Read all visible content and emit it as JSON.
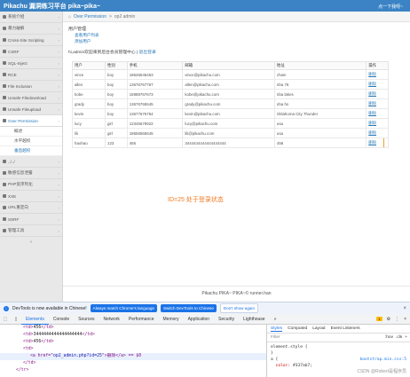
{
  "header": {
    "brand": "Pikachu 漏洞练习平台 pika~pika~",
    "right_link": "点一下我呀~"
  },
  "sidebar": {
    "items": [
      {
        "label": "系统介绍",
        "active": false
      },
      {
        "label": "暴力破解",
        "active": false
      },
      {
        "label": "Cross-Site Scripting",
        "active": false
      },
      {
        "label": "CSRF",
        "active": false
      },
      {
        "label": "SQL-Inject",
        "active": false
      },
      {
        "label": "RCE",
        "active": false
      },
      {
        "label": "File Inclusion",
        "active": false
      },
      {
        "label": "Unsafe Filedownload",
        "active": false
      },
      {
        "label": "Unsafe Fileupload",
        "active": false
      },
      {
        "label": "Over Permission",
        "active": true
      }
    ],
    "subitems": [
      {
        "label": "概述"
      },
      {
        "label": "水平越权"
      },
      {
        "label": "垂直越权"
      }
    ],
    "items2": [
      {
        "label": "../../"
      },
      {
        "label": "敏感信息泄露"
      },
      {
        "label": "PHP反序列化"
      },
      {
        "label": "XXE"
      },
      {
        "label": "URL重定向"
      },
      {
        "label": "SSRF"
      },
      {
        "label": "管理工具"
      }
    ],
    "collapse": "«"
  },
  "breadcrumb": {
    "home": "Over Permission",
    "sep": ">",
    "current": "op2 admin"
  },
  "content": {
    "title": "用户管理",
    "links": [
      "查看用户列表",
      "添加用户"
    ],
    "welcome": "hi,admin欢迎来到后台会员管理中心 |",
    "logout": "退出登录"
  },
  "table": {
    "headers": [
      "用户",
      "性别",
      "手机",
      "邮箱",
      "地址",
      "操作"
    ],
    "rows": [
      [
        "vince",
        "boy",
        "18626545453",
        "vince@pikachu.com",
        "chain",
        "删除"
      ],
      [
        "allen",
        "boy",
        "13676767767",
        "allen@pikachu.com",
        "nba 76",
        "删除"
      ],
      [
        "kobe",
        "boy",
        "15988767673",
        "kobe@pikachu.com",
        "nba lakes",
        "删除"
      ],
      [
        "grady",
        "boy",
        "13676765545",
        "grady@pikachu.com",
        "nba hs",
        "删除"
      ],
      [
        "kevin",
        "boy",
        "13677676754",
        "kevin@pikachu.com",
        "Oklahoma City Thunder",
        "删除"
      ],
      [
        "lucy",
        "girl",
        "12345678922",
        "lucy@pikachu.com",
        "usa",
        "删除"
      ],
      [
        "lili",
        "girl",
        "18656565545",
        "lili@pikachu.com",
        "usa",
        "删除"
      ],
      [
        "haohao",
        "123",
        "456",
        "3444444444444444444",
        "456",
        "删除"
      ]
    ]
  },
  "annotation": "ID=25 处于登录状态",
  "footer": "Pikachu PIKA~ PIKA~© runner.han",
  "devtools": {
    "infobar": {
      "text": "DevTools is now available in Chinese!",
      "btn1": "Always match Chrome's language",
      "btn2": "Switch DevTools to Chinese",
      "btn3": "Don't show again",
      "close": "×"
    },
    "tabs": [
      "Elements",
      "Console",
      "Sources",
      "Network",
      "Performance",
      "Memory",
      "Application",
      "Security",
      "Lighthouse"
    ],
    "more": "»",
    "badge": "1",
    "elements_lines": [
      {
        "pre": "<td>",
        "text": "456",
        "post": "</td>"
      },
      {
        "pre": "<td>",
        "text": "3444444444444444444",
        "post": "</td>"
      },
      {
        "pre": "<td>",
        "text": "456",
        "post": "</td>"
      },
      {
        "pre": "<td>",
        "text": "",
        "post": ""
      },
      {
        "pre": "<a href=\"",
        "text": "op2_admin.php?id=25",
        "post": "\">删除</a> == $0"
      },
      {
        "pre": "</td>",
        "text": "",
        "post": ""
      },
      {
        "pre": "</tr>",
        "text": "",
        "post": ""
      }
    ],
    "styles_tabs": [
      "Styles",
      "Computed",
      "Layout",
      "Event Listeners"
    ],
    "filter": "Filter",
    "filter_right": [
      ":hov",
      ".cls",
      "+"
    ],
    "rule1": "element.style {",
    "rule1_end": "}",
    "rule2": "a {",
    "prop": "color:",
    "value": "#337ab7;",
    "source": "bootstrap.min.css:5"
  },
  "watermark": "CSDN @Robert是程序员"
}
